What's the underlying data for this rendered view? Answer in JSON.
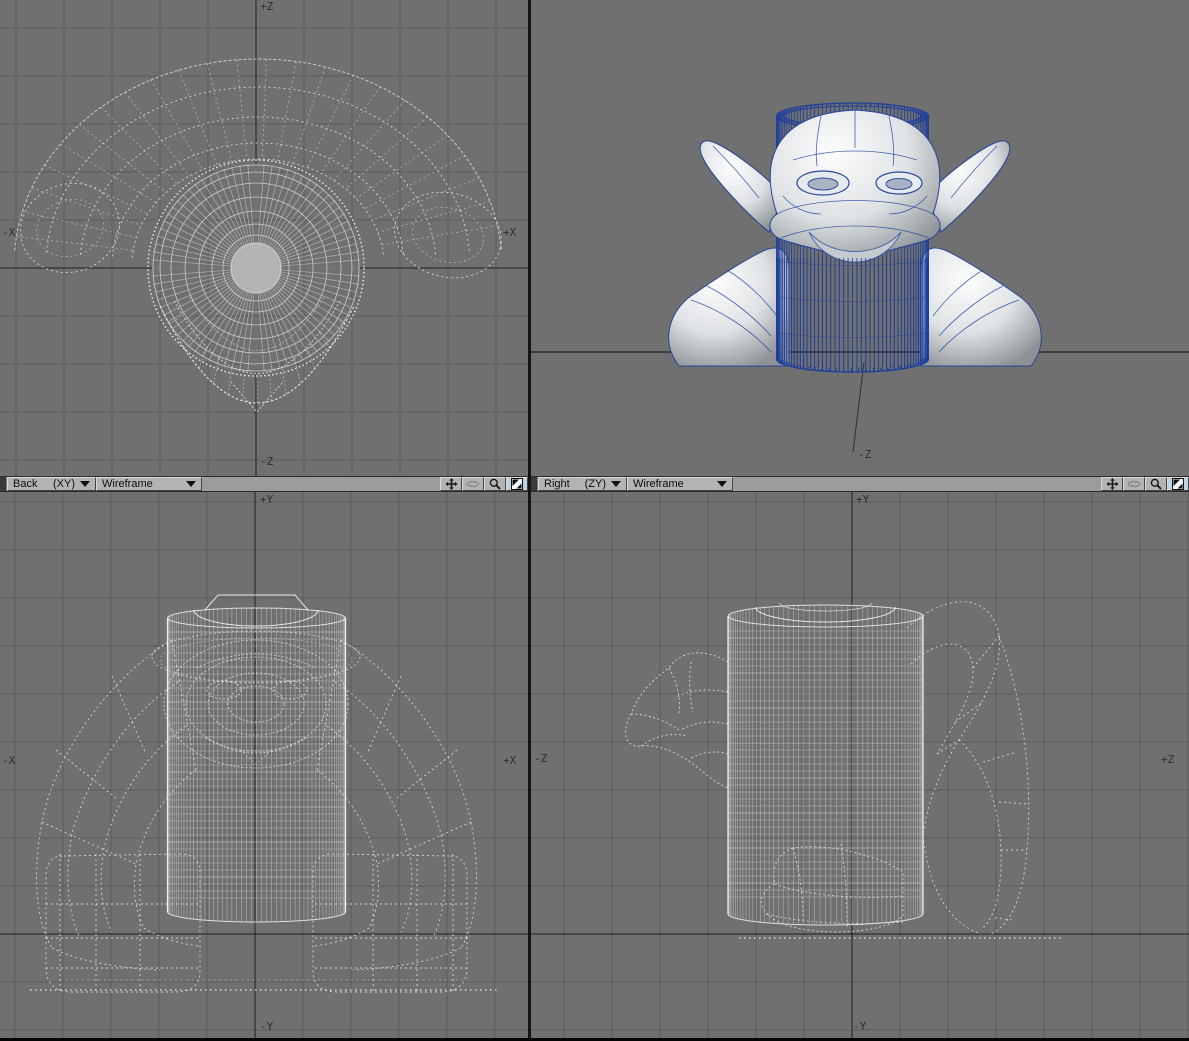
{
  "colors": {
    "viewport_bg": "#707070",
    "grid_line": "#5d5d5d",
    "axis_line": "#1f1f1f",
    "wire_dim": "#e1e1e1",
    "wire_mid": "#eeeeee",
    "wire_bright": "#fafafa",
    "label_color": "#2d2d2d",
    "toolbar_bg": "#9c9c9c",
    "button_bg": "#b3b3b3",
    "button_active_bg": "#bdd3e2",
    "divider": "#141414",
    "model_wire_blue": "#1e3f9c",
    "model_shade_light": "#fdfdfd",
    "model_shade_dark": "#8e9296",
    "ground_line": "#2e2e2e"
  },
  "viewports": {
    "top_left": {
      "axis_top": "+Z",
      "axis_bottom": "-Z",
      "axis_left": "-X",
      "axis_right": "+X"
    },
    "top_right": {
      "axis_bottom": "-Z"
    },
    "bottom_left": {
      "axis_top": "+Y",
      "axis_bottom": "-Y",
      "axis_left": "-X",
      "axis_right": "+X"
    },
    "bottom_right": {
      "axis_top": "+Y",
      "axis_bottom": "-Y",
      "axis_left": "-Z",
      "axis_right": "+Z"
    }
  },
  "toolbars": [
    {
      "view_label": "Back",
      "view_axes": "(XY)",
      "render_mode": "Wireframe",
      "icons": [
        "pan-icon",
        "rotate-icon",
        "zoom-icon",
        "maximize-icon"
      ]
    },
    {
      "view_label": "Right",
      "view_axes": "(ZY)",
      "render_mode": "Wireframe",
      "icons": [
        "pan-icon",
        "rotate-icon",
        "zoom-icon",
        "maximize-icon"
      ]
    }
  ]
}
